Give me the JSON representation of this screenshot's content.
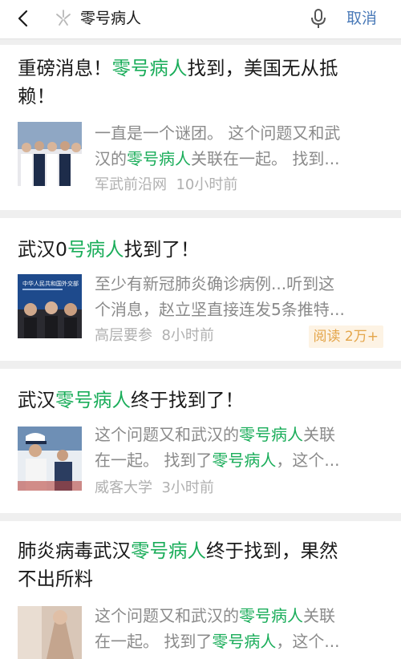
{
  "search": {
    "query": "零号病人",
    "cancel": "取消"
  },
  "results": [
    {
      "title": [
        "重磅消息！",
        "零号病人",
        "找到，美国无从抵",
        "赖！"
      ],
      "snippet1": [
        "一直是一个谜团。 这个问题又和武"
      ],
      "snippet2": [
        "汉的",
        "零号病人",
        "关联在一起。 找到..."
      ],
      "source": "军武前沿网",
      "time": "10小时前"
    },
    {
      "title": [
        "武汉0",
        "号病人",
        "找到了！"
      ],
      "snippet1": "至少有新冠肺炎确诊病例...听到这",
      "snippet2": "个消息，赵立坚直接连发5条推特...",
      "source": "高层要参",
      "time": "8小时前",
      "badge": "阅读 2万+",
      "thumb_text": "中华人民共和国外交部"
    },
    {
      "title": [
        "武汉",
        "零号病人",
        "终于找到了！"
      ],
      "snippet1": [
        "这个问题又和武汉的",
        "零号病人",
        "关联"
      ],
      "snippet2": [
        "在一起。 找到了",
        "零号病人",
        "，这个..."
      ],
      "source": "威客大学",
      "time": "3小时前"
    },
    {
      "title": [
        "肺炎病毒武汉",
        "零号病人",
        "终于找到，果然",
        "不出所料"
      ],
      "snippet1": [
        "这个问题又和武汉的",
        "零号病人",
        "关联"
      ],
      "snippet2": [
        "在一起。 找到了",
        "零号病人",
        "，这个..."
      ]
    }
  ],
  "icons": {
    "back": "back-arrow-icon",
    "search": "search-icon",
    "mic": "microphone-icon"
  },
  "colors": {
    "highlight": "#1aad5a",
    "cancel": "#4a7ab8",
    "badge": "#e4a64b"
  }
}
